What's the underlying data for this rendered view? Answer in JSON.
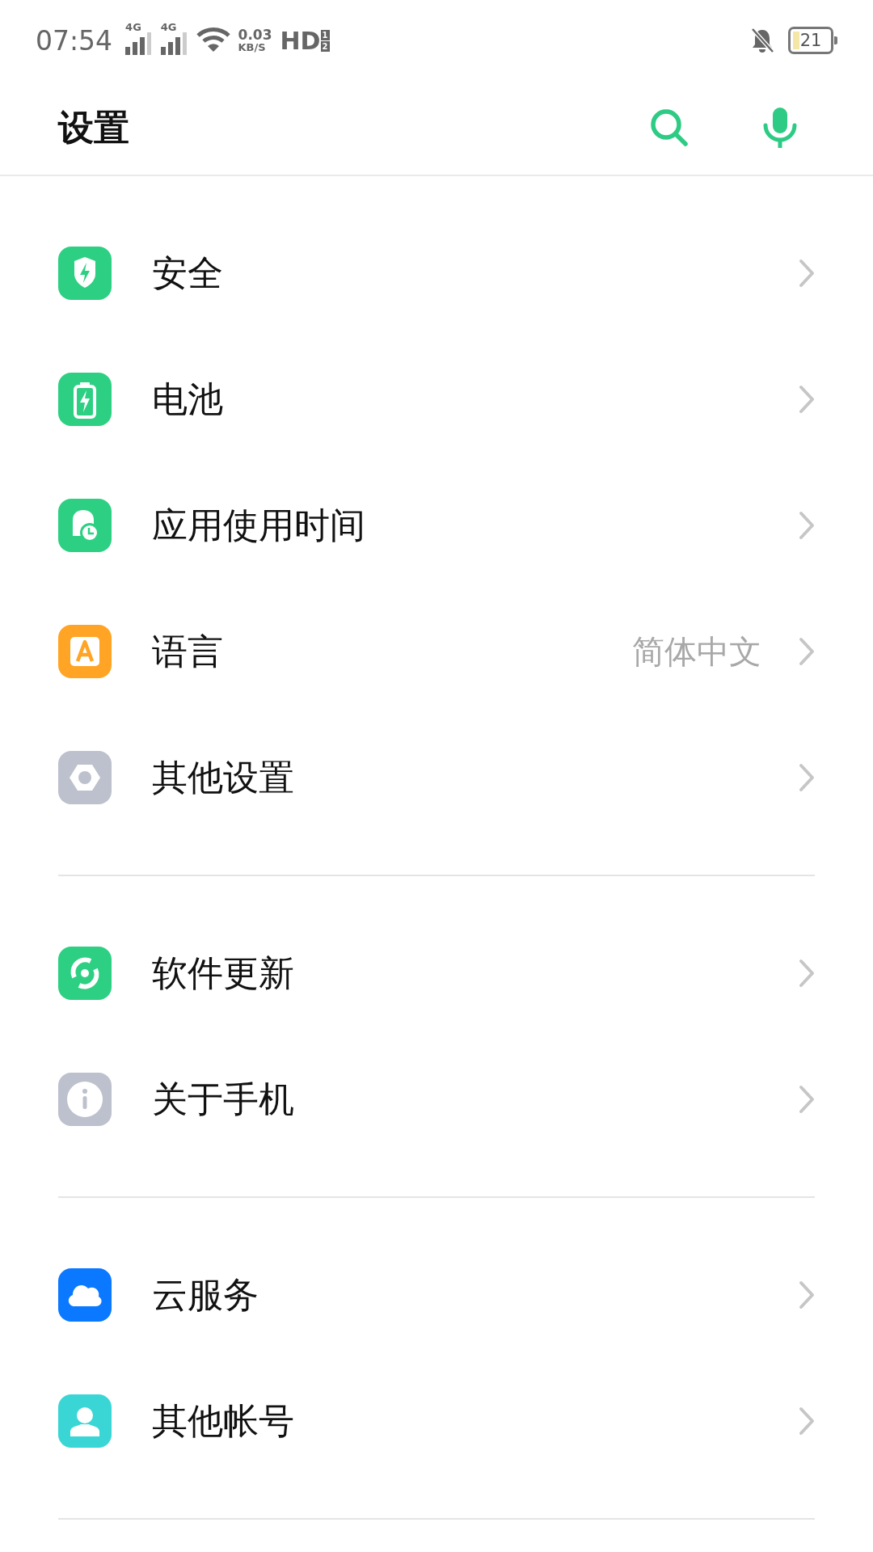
{
  "status_bar": {
    "time": "07:54",
    "signals": [
      "4G",
      "4G"
    ],
    "speed_value": "0.03",
    "speed_unit": "KB/S",
    "hd": "HD",
    "hd_slots": [
      "1",
      "2"
    ],
    "battery": "21"
  },
  "header": {
    "title": "设置"
  },
  "groups": [
    {
      "items": [
        {
          "label": "安全"
        },
        {
          "label": "电池"
        },
        {
          "label": "应用使用时间"
        },
        {
          "label": "语言",
          "value": "简体中文"
        },
        {
          "label": "其他设置"
        }
      ]
    },
    {
      "items": [
        {
          "label": "软件更新"
        },
        {
          "label": "关于手机"
        }
      ]
    },
    {
      "items": [
        {
          "label": "云服务"
        },
        {
          "label": "其他帐号"
        }
      ]
    }
  ]
}
